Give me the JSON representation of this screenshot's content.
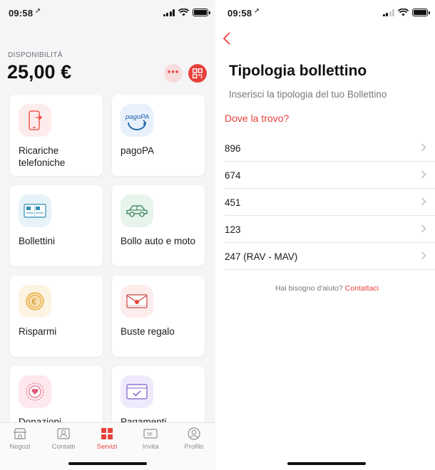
{
  "status_left": {
    "time": "09:58"
  },
  "status_right": {
    "time": "09:58"
  },
  "balance": {
    "label": "DISPONIBILITÀ",
    "amount": "25,00 €"
  },
  "services": [
    {
      "label": "Ricariche telefoniche",
      "icon": "phone-recharge-icon",
      "color": "#fdecec"
    },
    {
      "label": "pagoPA",
      "icon": "pagopa-logo-icon",
      "color": "#e8f1fb",
      "logo_text": "pagoPA"
    },
    {
      "label": "Bollettini",
      "icon": "bollettino-icon",
      "color": "#e6f3f8"
    },
    {
      "label": "Bollo auto e moto",
      "icon": "car-icon",
      "color": "#e7f4ec"
    },
    {
      "label": "Risparmi",
      "icon": "coin-euro-icon",
      "color": "#fdf3e3"
    },
    {
      "label": "Buste regalo",
      "icon": "gift-envelope-icon",
      "color": "#fdecec"
    },
    {
      "label": "Donazioni",
      "icon": "heart-icon",
      "color": "#fde8ee"
    },
    {
      "label": "Pagamenti",
      "icon": "payment-check-icon",
      "color": "#efeafb"
    }
  ],
  "tabbar": {
    "tabs": [
      {
        "label": "Negozi",
        "icon": "store-icon"
      },
      {
        "label": "Contatti",
        "icon": "contacts-icon"
      },
      {
        "label": "Servizi",
        "icon": "services-grid-icon",
        "active": true
      },
      {
        "label": "Invita",
        "icon": "invite-ticket-icon",
        "badge_text": "5€"
      },
      {
        "label": "Profilo",
        "icon": "profile-icon"
      }
    ]
  },
  "bollettino": {
    "title": "Tipologia bollettino",
    "subtitle": "Inserisci la tipologia del tuo Bollettino",
    "where_link": "Dove la trovo?",
    "types": [
      "896",
      "674",
      "451",
      "123",
      "247 (RAV - MAV)"
    ],
    "help_text": "Hai bisogno d'aiuto?",
    "help_link": "Contattaci"
  },
  "colors": {
    "accent": "#e8413b",
    "text": "#1a1a1a",
    "muted": "#7a7a7f",
    "background": "#f5f5f7"
  }
}
